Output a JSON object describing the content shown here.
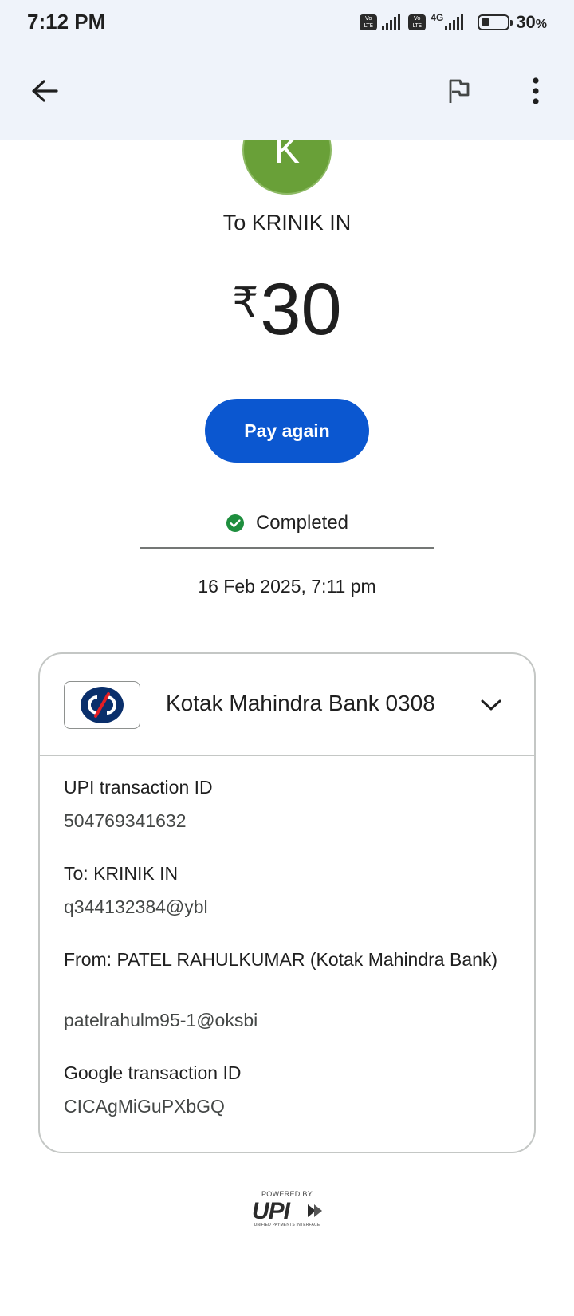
{
  "status_bar": {
    "time": "7:12 PM",
    "network": "4G",
    "volte_label": "Vo LTE",
    "battery": "30",
    "battery_suffix": "%"
  },
  "appbar": {
    "back_icon": "arrow-left-icon",
    "flag_icon": "flag-icon",
    "more_icon": "more-vert-icon"
  },
  "avatar": {
    "initial": "K",
    "color": "#69a038"
  },
  "payee": {
    "to_label": "To KRINIK IN"
  },
  "amount": {
    "currency": "₹",
    "value": "30"
  },
  "actions": {
    "pay_again": "Pay again"
  },
  "status": {
    "text": "Completed",
    "color": "#1e8e3e"
  },
  "datetime": "16 Feb 2025, 7:11 pm",
  "card": {
    "bank_name": "Kotak Mahindra Bank 0308",
    "details": [
      {
        "label": "UPI transaction ID",
        "value": "504769341632"
      },
      {
        "label": "To: KRINIK IN",
        "value": "q344132384@ybl"
      },
      {
        "label": "From: PATEL  RAHULKUMAR (Kotak Mahindra Bank)",
        "value": "patelrahulm95-1@oksbi"
      },
      {
        "label": "Google transaction ID",
        "value": "CICAgMiGuPXbGQ"
      }
    ]
  },
  "footer": {
    "powered_by": "POWERED BY",
    "upi": "UPI",
    "upi_sub": "UNIFIED PAYMENTS INTERFACE"
  },
  "colors": {
    "primary": "#0b57d0",
    "appbar_bg": "#eff3fa"
  }
}
